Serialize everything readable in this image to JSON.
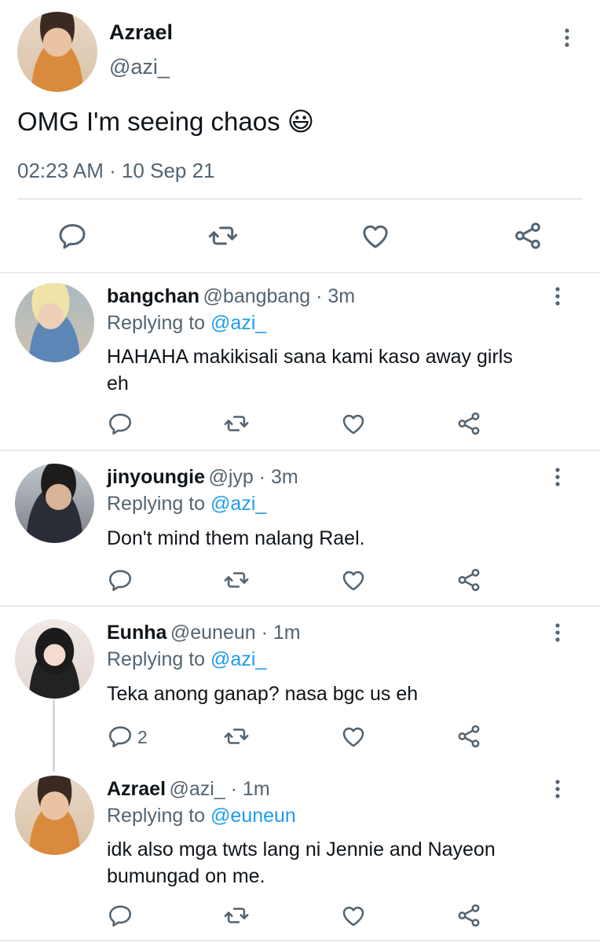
{
  "main_tweet": {
    "author_name": "Azrael",
    "author_handle": "@azi_",
    "text": "OMG I'm seeing chaos 😃",
    "timestamp": "02:23 AM · 10 Sep 21"
  },
  "replies": [
    {
      "name": "bangchan",
      "handle_time": "@bangbang · 3m",
      "replying_label": "Replying to",
      "replying_to": "@azi_",
      "text_line1": "HAHAHA makikisali sana kami kaso away girls",
      "text_line2": "eh",
      "reply_count": ""
    },
    {
      "name": "jinyoungie",
      "handle_time": "@jyp · 3m",
      "replying_label": "Replying to",
      "replying_to": "@azi_",
      "text_line1": "Don't mind them nalang Rael.",
      "text_line2": "",
      "reply_count": ""
    },
    {
      "name": "Eunha",
      "handle_time": "@euneun · 1m",
      "replying_label": "Replying to",
      "replying_to": "@azi_",
      "text_line1": "Teka anong ganap? nasa bgc us eh",
      "text_line2": "",
      "reply_count": "2"
    },
    {
      "name": "Azrael",
      "handle_time": "@azi_ · 1m",
      "replying_label": "Replying to",
      "replying_to": "@euneun",
      "text_line1": "idk also mga twts lang ni Jennie and Nayeon",
      "text_line2": "bumungad on me.",
      "reply_count": ""
    }
  ],
  "icons": {
    "reply": "reply-icon",
    "retweet": "retweet-icon",
    "like": "heart-icon",
    "share": "share-icon",
    "more": "more-vertical-icon"
  },
  "colors": {
    "link": "#1d9bf0",
    "secondary": "#536471",
    "divider": "#e6e9ec"
  }
}
